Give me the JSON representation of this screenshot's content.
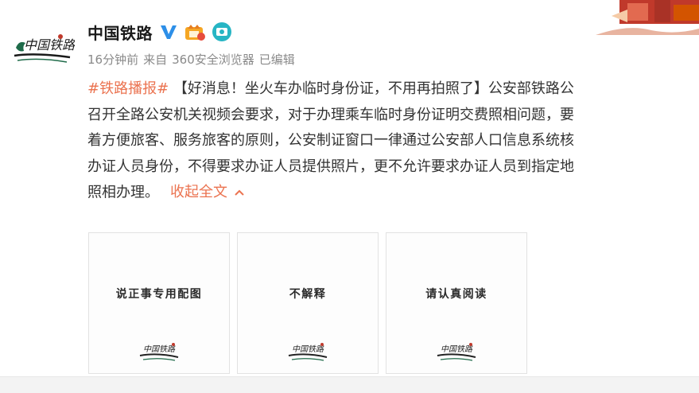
{
  "author": {
    "name": "中国铁路",
    "verified_icon": "verified-v-icon",
    "badge_icons": [
      "member-crown-icon",
      "camera-badge-icon"
    ]
  },
  "meta": {
    "time": "16分钟前",
    "source_prefix": "来自",
    "source": "360安全浏览器",
    "edited": "已编辑"
  },
  "post": {
    "topic": "#铁路播报#",
    "lines": [
      "【好消息！坐火车办临时身份证，不用再拍照了】公安部铁路公",
      "召开全路公安机关视频会要求，对于办理乘车临时身份证明交费照相问题，要",
      "着方便旅客、服务旅客的原则，公安制证窗口一律通过公安部人口信息系统核",
      "办证人员身份，不得要求办证人员提供照片，更不允许要求办证人员到指定地",
      "照相办理。"
    ],
    "collapse_label": "收起全文"
  },
  "images": [
    {
      "caption": "说正事专用配图"
    },
    {
      "caption": "不解释"
    },
    {
      "caption": "请认真阅读"
    }
  ],
  "colors": {
    "accent": "#eb7350",
    "verified": "#2d8fe8",
    "meta": "#8a8a8a"
  }
}
